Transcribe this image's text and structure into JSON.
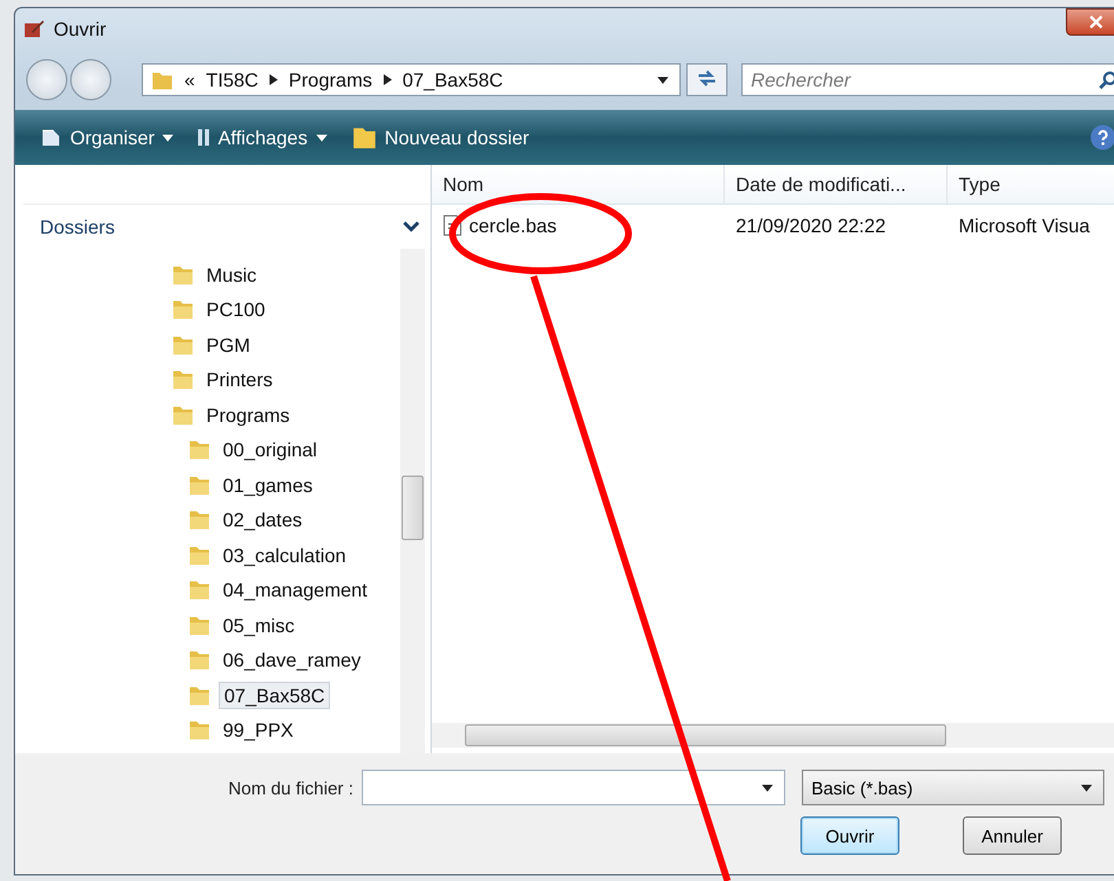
{
  "window": {
    "title": "Ouvrir"
  },
  "address": {
    "overflow": "«",
    "crumbs": [
      "TI58C",
      "Programs",
      "07_Bax58C"
    ]
  },
  "search": {
    "placeholder": "Rechercher"
  },
  "toolbar": [
    {
      "kind": "organize",
      "label": "Organiser",
      "dropdown": true
    },
    {
      "kind": "views",
      "label": "Affichages",
      "dropdown": true
    },
    {
      "kind": "new-folder",
      "label": "Nouveau dossier",
      "dropdown": false
    }
  ],
  "sidebar": {
    "title": "Dossiers",
    "items": [
      {
        "label": "Music",
        "selected": false
      },
      {
        "label": "PC100",
        "selected": false
      },
      {
        "label": "PGM",
        "selected": false
      },
      {
        "label": "Printers",
        "selected": false
      },
      {
        "label": "Programs",
        "selected": false,
        "children": [
          {
            "label": "00_original",
            "selected": false
          },
          {
            "label": "01_games",
            "selected": false
          },
          {
            "label": "02_dates",
            "selected": false
          },
          {
            "label": "03_calculation",
            "selected": false
          },
          {
            "label": "04_management",
            "selected": false
          },
          {
            "label": "05_misc",
            "selected": false
          },
          {
            "label": "06_dave_ramey",
            "selected": false
          },
          {
            "label": "07_Bax58C",
            "selected": true
          },
          {
            "label": "99_PPX",
            "selected": false
          }
        ]
      }
    ]
  },
  "table": {
    "columns": [
      "Nom",
      "Date de modificati...",
      "Type"
    ],
    "rows": [
      {
        "name": "cercle.bas",
        "date": "21/09/2020 22:22",
        "type": "Microsoft Visua"
      }
    ]
  },
  "filename": {
    "label": "Nom du fichier :"
  },
  "filetype": {
    "value": "Basic (*.bas)"
  },
  "buttons": [
    {
      "label": "Ouvrir",
      "default": true
    },
    {
      "label": "Annuler",
      "default": false
    }
  ]
}
